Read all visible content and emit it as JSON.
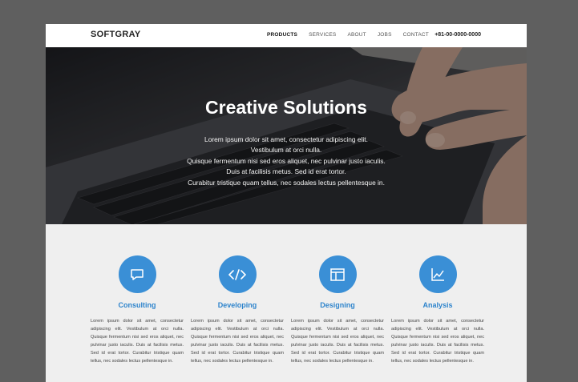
{
  "header": {
    "brand": "SOFTGRAY",
    "nav": [
      "PRODUCTS",
      "SERVICES",
      "ABOUT",
      "JOBS",
      "CONTACT"
    ],
    "phone": "+81-00-0000-0000"
  },
  "hero": {
    "title": "Creative Solutions",
    "lines": [
      "Lorem ipsum dolor sit amet, consectetur adipiscing elit.",
      "Vestibulum at orci nulla.",
      "Quisque fermentum nisi sed eros aliquet, nec pulvinar justo iaculis.",
      "Duis at facilisis metus. Sed id erat tortor.",
      "Curabitur tristique quam tellus, nec sodales lectus pellentesque in."
    ]
  },
  "features": [
    {
      "icon": "chat-icon",
      "title": "Consulting",
      "text": "Lorem ipsum dolor sit amet, consectetur adipiscing elit. Vestibulum at orci nulla. Quisque fermentum nisi sed eros aliquet, nec pulvinar justo iaculis. Duis at facilisis metus. Sed id erat tortor. Curabitur tristique quam tellus, nec sodales lectus pellentesque in."
    },
    {
      "icon": "code-icon",
      "title": "Developing",
      "text": "Lorem ipsum dolor sit amet, consectetur adipiscing elit. Vestibulum at orci nulla. Quisque fermentum nisi sed eros aliquet, nec pulvinar justo iaculis. Duis at facilisis metus. Sed id erat tortor. Curabitur tristique quam tellus, nec sodales lectus pellentesque in."
    },
    {
      "icon": "layout-icon",
      "title": "Designing",
      "text": "Lorem ipsum dolor sit amet, consectetur adipiscing elit. Vestibulum at orci nulla. Quisque fermentum nisi sed eros aliquet, nec pulvinar justo iaculis. Duis at facilisis metus. Sed id erat tortor. Curabitur tristique quam tellus, nec sodales lectus pellentesque in."
    },
    {
      "icon": "chart-icon",
      "title": "Analysis",
      "text": "Lorem ipsum dolor sit amet, consectetur adipiscing elit. Vestibulum at orci nulla. Quisque fermentum nisi sed eros aliquet, nec pulvinar justo iaculis. Duis at facilisis metus. Sed id erat tortor. Curabitur tristique quam tellus, nec sodales lectus pellentesque in."
    }
  ],
  "colors": {
    "accent": "#3a8fd6",
    "title": "#2e84cc",
    "backdrop": "#5f5f5f"
  }
}
